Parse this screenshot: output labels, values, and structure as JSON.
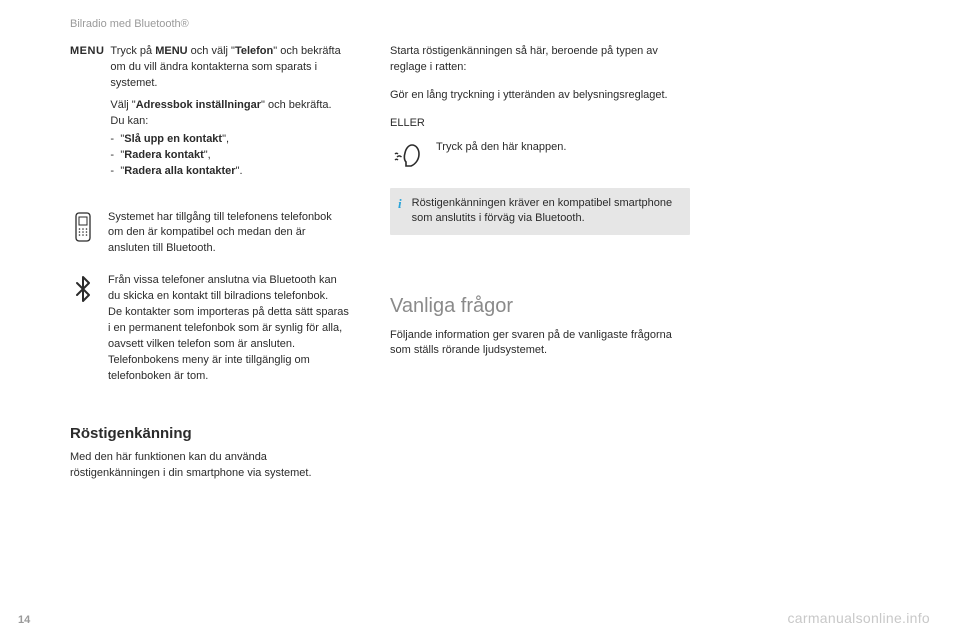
{
  "header": "Bilradio med Bluetooth®",
  "page_number": "14",
  "watermark": "carmanualsonline.info",
  "left": {
    "menu_label": "MENU",
    "menu_line1_pre": "Tryck på ",
    "menu_line1_b1": "MENU",
    "menu_line1_mid": " och välj \"",
    "menu_line1_b2": "Telefon",
    "menu_line1_post": "\" och bekräfta om du vill ändra kontakterna som sparats i systemet.",
    "menu_line2_pre": "Välj \"",
    "menu_line2_b": "Adressbok inställningar",
    "menu_line2_post": "\" och bekräfta.",
    "menu_line3": "Du kan:",
    "bullets": {
      "b1_pre": "\"",
      "b1_b": "Slå upp en kontakt",
      "b1_post": "\",",
      "b2_pre": "\"",
      "b2_b": "Radera kontakt",
      "b2_post": "\",",
      "b3_pre": "\"",
      "b3_b": "Radera alla kontakter",
      "b3_post": "\"."
    },
    "phone_text": "Systemet har tillgång till telefonens telefonbok om den är kompatibel och medan den är ansluten till Bluetooth.",
    "bt_text1": "Från vissa telefoner anslutna via Bluetooth kan du skicka en kontakt till bilradions telefonbok.",
    "bt_text2": "De kontakter som importeras på detta sätt sparas i en permanent telefonbok som är synlig för alla, oavsett vilken telefon som är ansluten.",
    "bt_text3": "Telefonbokens meny är inte tillgänglig om telefonboken är tom.",
    "h3": "Röstigenkänning",
    "h3_body": "Med den här funktionen kan du använda röstigenkänningen i din smartphone via systemet."
  },
  "right": {
    "p1": "Starta röstigenkänningen så här, beroende på typen av reglage i ratten:",
    "p2": "Gör en lång tryckning i ytteränden av belysningsreglaget.",
    "eller": "ELLER",
    "voice_btn": "Tryck på den här knappen.",
    "info": "Röstigenkänningen kräver en kompatibel smartphone som anslutits i förväg via Bluetooth.",
    "h2": "Vanliga frågor",
    "h2_body": "Följande information ger svaren på de vanligaste frågorna som ställs rörande ljudsystemet."
  }
}
